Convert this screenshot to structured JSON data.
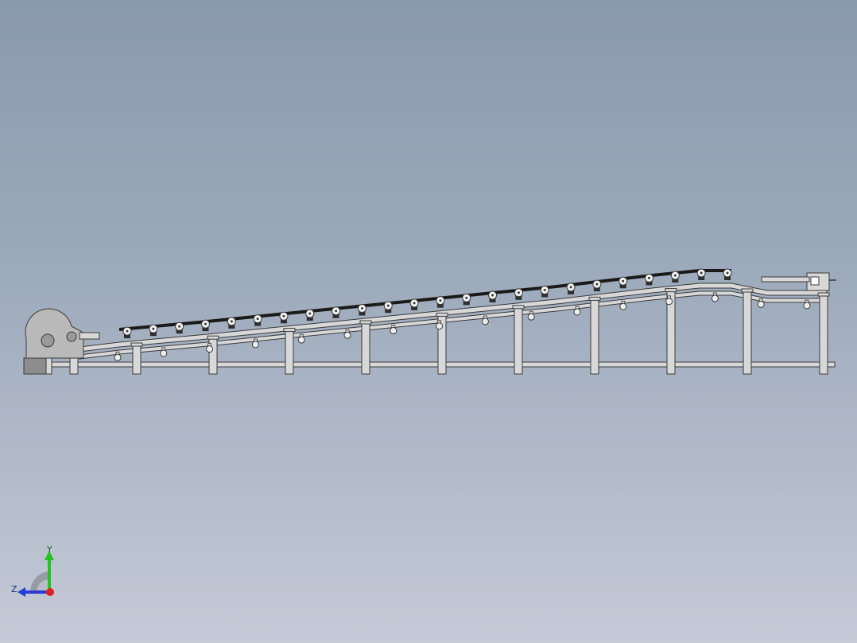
{
  "view": {
    "background_top": "#8a9aad",
    "background_bottom": "#c4cad6",
    "model_line_color": "#3a3a3a",
    "model_fill_color": "#d8d8d8",
    "roller_color": "#2e2e2e",
    "belt_color": "#1a1a1a"
  },
  "model": {
    "description_icon": "inclined-belt-conveyor",
    "support_leg_count": 10,
    "carrying_roller_count": 24,
    "return_roller_count": 16
  },
  "triad": {
    "y_label": "Y",
    "z_label": "Z",
    "y_color": "#22c422",
    "z_color": "#2a3bd6",
    "x_color": "#e02020"
  }
}
